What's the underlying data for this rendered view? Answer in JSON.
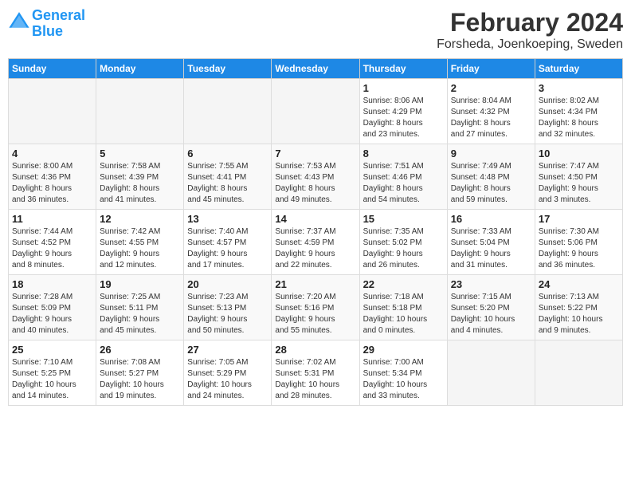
{
  "header": {
    "logo_line1": "General",
    "logo_line2": "Blue",
    "title": "February 2024",
    "subtitle": "Forsheda, Joenkoeping, Sweden"
  },
  "weekdays": [
    "Sunday",
    "Monday",
    "Tuesday",
    "Wednesday",
    "Thursday",
    "Friday",
    "Saturday"
  ],
  "weeks": [
    [
      {
        "day": "",
        "info": ""
      },
      {
        "day": "",
        "info": ""
      },
      {
        "day": "",
        "info": ""
      },
      {
        "day": "",
        "info": ""
      },
      {
        "day": "1",
        "info": "Sunrise: 8:06 AM\nSunset: 4:29 PM\nDaylight: 8 hours\nand 23 minutes."
      },
      {
        "day": "2",
        "info": "Sunrise: 8:04 AM\nSunset: 4:32 PM\nDaylight: 8 hours\nand 27 minutes."
      },
      {
        "day": "3",
        "info": "Sunrise: 8:02 AM\nSunset: 4:34 PM\nDaylight: 8 hours\nand 32 minutes."
      }
    ],
    [
      {
        "day": "4",
        "info": "Sunrise: 8:00 AM\nSunset: 4:36 PM\nDaylight: 8 hours\nand 36 minutes."
      },
      {
        "day": "5",
        "info": "Sunrise: 7:58 AM\nSunset: 4:39 PM\nDaylight: 8 hours\nand 41 minutes."
      },
      {
        "day": "6",
        "info": "Sunrise: 7:55 AM\nSunset: 4:41 PM\nDaylight: 8 hours\nand 45 minutes."
      },
      {
        "day": "7",
        "info": "Sunrise: 7:53 AM\nSunset: 4:43 PM\nDaylight: 8 hours\nand 49 minutes."
      },
      {
        "day": "8",
        "info": "Sunrise: 7:51 AM\nSunset: 4:46 PM\nDaylight: 8 hours\nand 54 minutes."
      },
      {
        "day": "9",
        "info": "Sunrise: 7:49 AM\nSunset: 4:48 PM\nDaylight: 8 hours\nand 59 minutes."
      },
      {
        "day": "10",
        "info": "Sunrise: 7:47 AM\nSunset: 4:50 PM\nDaylight: 9 hours\nand 3 minutes."
      }
    ],
    [
      {
        "day": "11",
        "info": "Sunrise: 7:44 AM\nSunset: 4:52 PM\nDaylight: 9 hours\nand 8 minutes."
      },
      {
        "day": "12",
        "info": "Sunrise: 7:42 AM\nSunset: 4:55 PM\nDaylight: 9 hours\nand 12 minutes."
      },
      {
        "day": "13",
        "info": "Sunrise: 7:40 AM\nSunset: 4:57 PM\nDaylight: 9 hours\nand 17 minutes."
      },
      {
        "day": "14",
        "info": "Sunrise: 7:37 AM\nSunset: 4:59 PM\nDaylight: 9 hours\nand 22 minutes."
      },
      {
        "day": "15",
        "info": "Sunrise: 7:35 AM\nSunset: 5:02 PM\nDaylight: 9 hours\nand 26 minutes."
      },
      {
        "day": "16",
        "info": "Sunrise: 7:33 AM\nSunset: 5:04 PM\nDaylight: 9 hours\nand 31 minutes."
      },
      {
        "day": "17",
        "info": "Sunrise: 7:30 AM\nSunset: 5:06 PM\nDaylight: 9 hours\nand 36 minutes."
      }
    ],
    [
      {
        "day": "18",
        "info": "Sunrise: 7:28 AM\nSunset: 5:09 PM\nDaylight: 9 hours\nand 40 minutes."
      },
      {
        "day": "19",
        "info": "Sunrise: 7:25 AM\nSunset: 5:11 PM\nDaylight: 9 hours\nand 45 minutes."
      },
      {
        "day": "20",
        "info": "Sunrise: 7:23 AM\nSunset: 5:13 PM\nDaylight: 9 hours\nand 50 minutes."
      },
      {
        "day": "21",
        "info": "Sunrise: 7:20 AM\nSunset: 5:16 PM\nDaylight: 9 hours\nand 55 minutes."
      },
      {
        "day": "22",
        "info": "Sunrise: 7:18 AM\nSunset: 5:18 PM\nDaylight: 10 hours\nand 0 minutes."
      },
      {
        "day": "23",
        "info": "Sunrise: 7:15 AM\nSunset: 5:20 PM\nDaylight: 10 hours\nand 4 minutes."
      },
      {
        "day": "24",
        "info": "Sunrise: 7:13 AM\nSunset: 5:22 PM\nDaylight: 10 hours\nand 9 minutes."
      }
    ],
    [
      {
        "day": "25",
        "info": "Sunrise: 7:10 AM\nSunset: 5:25 PM\nDaylight: 10 hours\nand 14 minutes."
      },
      {
        "day": "26",
        "info": "Sunrise: 7:08 AM\nSunset: 5:27 PM\nDaylight: 10 hours\nand 19 minutes."
      },
      {
        "day": "27",
        "info": "Sunrise: 7:05 AM\nSunset: 5:29 PM\nDaylight: 10 hours\nand 24 minutes."
      },
      {
        "day": "28",
        "info": "Sunrise: 7:02 AM\nSunset: 5:31 PM\nDaylight: 10 hours\nand 28 minutes."
      },
      {
        "day": "29",
        "info": "Sunrise: 7:00 AM\nSunset: 5:34 PM\nDaylight: 10 hours\nand 33 minutes."
      },
      {
        "day": "",
        "info": ""
      },
      {
        "day": "",
        "info": ""
      }
    ]
  ]
}
